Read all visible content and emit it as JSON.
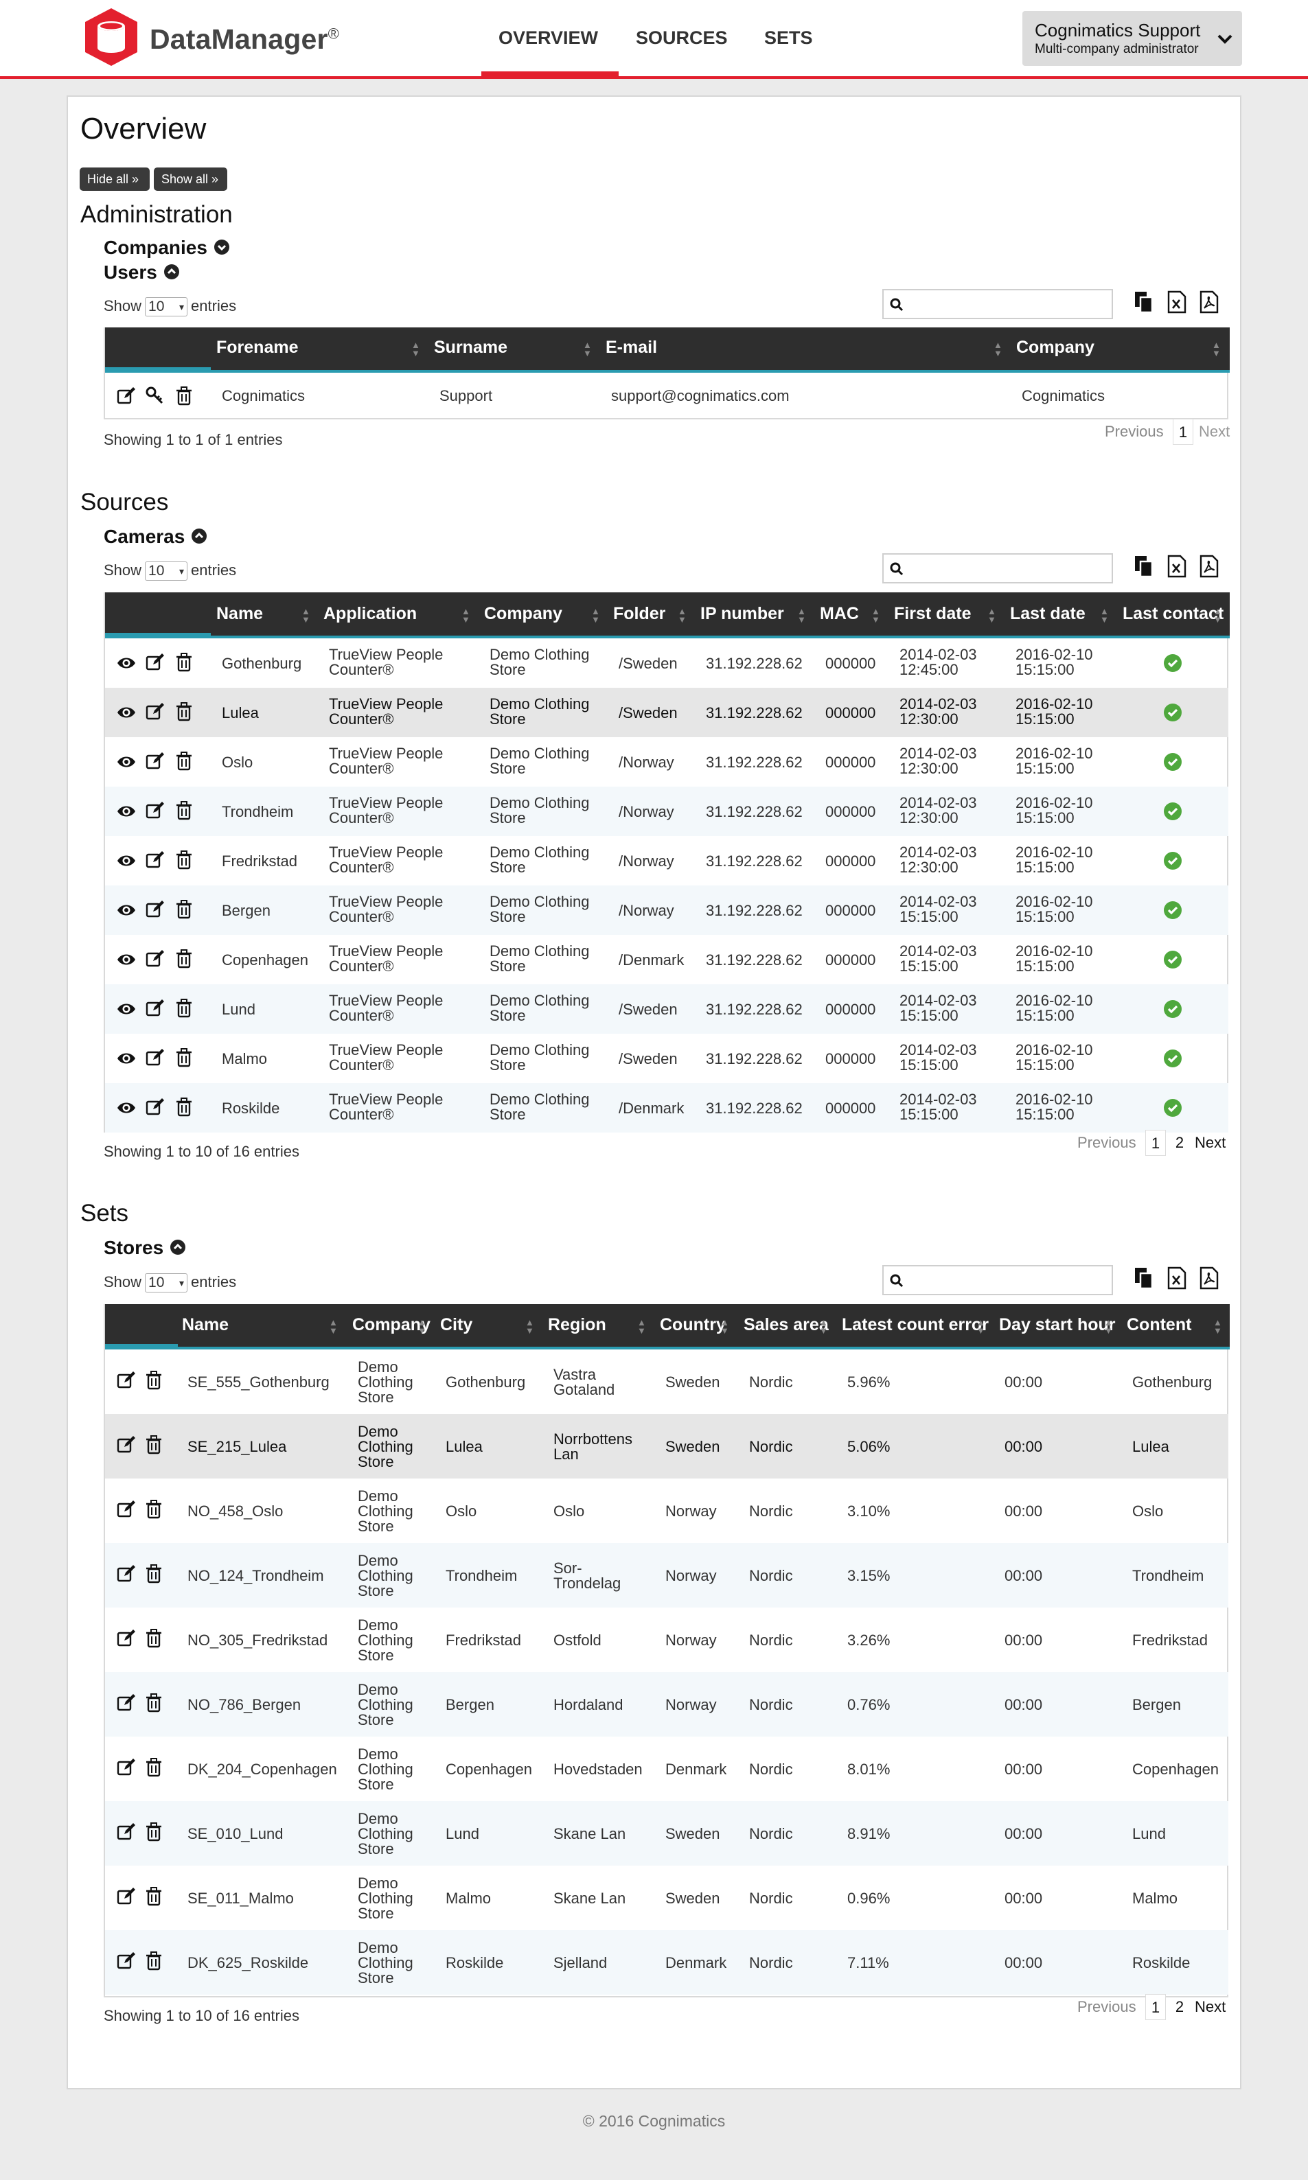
{
  "header": {
    "brand": "DataManager",
    "brand_mark": "®",
    "nav": [
      "OVERVIEW",
      "SOURCES",
      "SETS"
    ],
    "user_name": "Cognimatics Support",
    "user_role": "Multi-company administrator"
  },
  "page": {
    "title": "Overview",
    "hide_all": "Hide all »",
    "show_all": "Show all »"
  },
  "administration": {
    "title": "Administration",
    "companies": "Companies",
    "users": "Users",
    "show_label": "Show",
    "entries_label": "entries",
    "page_size": "10",
    "columns": [
      "Forename",
      "Surname",
      "E-mail",
      "Company"
    ],
    "rows": [
      {
        "forename": "Cognimatics",
        "surname": "Support",
        "email": "support@cognimatics.com",
        "company": "Cognimatics"
      }
    ],
    "info": "Showing 1 to 1 of 1 entries",
    "prev": "Previous",
    "pages": [
      "1"
    ],
    "next": "Next"
  },
  "sources": {
    "title": "Sources",
    "cameras": "Cameras",
    "show_label": "Show",
    "entries_label": "entries",
    "page_size": "10",
    "columns": [
      "Name",
      "Application",
      "Company",
      "Folder",
      "IP number",
      "MAC",
      "First date",
      "Last date",
      "Last contact"
    ],
    "rows": [
      {
        "name": "Gothenburg",
        "app1": "TrueView People",
        "app2": "Counter®",
        "co1": "Demo Clothing",
        "co2": "Store",
        "folder": "/Sweden",
        "ip": "31.192.228.62",
        "mac": "000000",
        "fd1": "2014-02-03",
        "fd2": "12:45:00",
        "ld1": "2016-02-10",
        "ld2": "15:15:00"
      },
      {
        "name": "Lulea",
        "app1": "TrueView People",
        "app2": "Counter®",
        "co1": "Demo Clothing",
        "co2": "Store",
        "folder": "/Sweden",
        "ip": "31.192.228.62",
        "mac": "000000",
        "fd1": "2014-02-03",
        "fd2": "12:30:00",
        "ld1": "2016-02-10",
        "ld2": "15:15:00"
      },
      {
        "name": "Oslo",
        "app1": "TrueView People",
        "app2": "Counter®",
        "co1": "Demo Clothing",
        "co2": "Store",
        "folder": "/Norway",
        "ip": "31.192.228.62",
        "mac": "000000",
        "fd1": "2014-02-03",
        "fd2": "12:30:00",
        "ld1": "2016-02-10",
        "ld2": "15:15:00"
      },
      {
        "name": "Trondheim",
        "app1": "TrueView People",
        "app2": "Counter®",
        "co1": "Demo Clothing",
        "co2": "Store",
        "folder": "/Norway",
        "ip": "31.192.228.62",
        "mac": "000000",
        "fd1": "2014-02-03",
        "fd2": "12:30:00",
        "ld1": "2016-02-10",
        "ld2": "15:15:00"
      },
      {
        "name": "Fredrikstad",
        "app1": "TrueView People",
        "app2": "Counter®",
        "co1": "Demo Clothing",
        "co2": "Store",
        "folder": "/Norway",
        "ip": "31.192.228.62",
        "mac": "000000",
        "fd1": "2014-02-03",
        "fd2": "12:30:00",
        "ld1": "2016-02-10",
        "ld2": "15:15:00"
      },
      {
        "name": "Bergen",
        "app1": "TrueView People",
        "app2": "Counter®",
        "co1": "Demo Clothing",
        "co2": "Store",
        "folder": "/Norway",
        "ip": "31.192.228.62",
        "mac": "000000",
        "fd1": "2014-02-03",
        "fd2": "15:15:00",
        "ld1": "2016-02-10",
        "ld2": "15:15:00"
      },
      {
        "name": "Copenhagen",
        "app1": "TrueView People",
        "app2": "Counter®",
        "co1": "Demo Clothing",
        "co2": "Store",
        "folder": "/Denmark",
        "ip": "31.192.228.62",
        "mac": "000000",
        "fd1": "2014-02-03",
        "fd2": "15:15:00",
        "ld1": "2016-02-10",
        "ld2": "15:15:00"
      },
      {
        "name": "Lund",
        "app1": "TrueView People",
        "app2": "Counter®",
        "co1": "Demo Clothing",
        "co2": "Store",
        "folder": "/Sweden",
        "ip": "31.192.228.62",
        "mac": "000000",
        "fd1": "2014-02-03",
        "fd2": "15:15:00",
        "ld1": "2016-02-10",
        "ld2": "15:15:00"
      },
      {
        "name": "Malmo",
        "app1": "TrueView People",
        "app2": "Counter®",
        "co1": "Demo Clothing",
        "co2": "Store",
        "folder": "/Sweden",
        "ip": "31.192.228.62",
        "mac": "000000",
        "fd1": "2014-02-03",
        "fd2": "15:15:00",
        "ld1": "2016-02-10",
        "ld2": "15:15:00"
      },
      {
        "name": "Roskilde",
        "app1": "TrueView People",
        "app2": "Counter®",
        "co1": "Demo Clothing",
        "co2": "Store",
        "folder": "/Denmark",
        "ip": "31.192.228.62",
        "mac": "000000",
        "fd1": "2014-02-03",
        "fd2": "15:15:00",
        "ld1": "2016-02-10",
        "ld2": "15:15:00"
      }
    ],
    "info": "Showing 1 to 10 of 16 entries",
    "prev": "Previous",
    "pages": [
      "1",
      "2"
    ],
    "next": "Next"
  },
  "sets": {
    "title": "Sets",
    "stores": "Stores",
    "show_label": "Show",
    "entries_label": "entries",
    "page_size": "10",
    "columns": [
      "Name",
      "Company",
      "City",
      "Region",
      "Country",
      "Sales area",
      "Latest count error",
      "Day start hour",
      "Content"
    ],
    "rows": [
      {
        "name": "SE_555_Gothenburg",
        "city": "Gothenburg",
        "r1": "Vastra",
        "r2": "Gotaland",
        "country": "Sweden",
        "area": "Nordic",
        "err": "5.96%",
        "hour": "00:00",
        "content": "Gothenburg"
      },
      {
        "name": "SE_215_Lulea",
        "city": "Lulea",
        "r1": "Norrbottens",
        "r2": "Lan",
        "country": "Sweden",
        "area": "Nordic",
        "err": "5.06%",
        "hour": "00:00",
        "content": "Lulea"
      },
      {
        "name": "NO_458_Oslo",
        "city": "Oslo",
        "r1": "Oslo",
        "r2": "",
        "country": "Norway",
        "area": "Nordic",
        "err": "3.10%",
        "hour": "00:00",
        "content": "Oslo"
      },
      {
        "name": "NO_124_Trondheim",
        "city": "Trondheim",
        "r1": "Sor-",
        "r2": "Trondelag",
        "country": "Norway",
        "area": "Nordic",
        "err": "3.15%",
        "hour": "00:00",
        "content": "Trondheim"
      },
      {
        "name": "NO_305_Fredrikstad",
        "city": "Fredrikstad",
        "r1": "Ostfold",
        "r2": "",
        "country": "Norway",
        "area": "Nordic",
        "err": "3.26%",
        "hour": "00:00",
        "content": "Fredrikstad"
      },
      {
        "name": "NO_786_Bergen",
        "city": "Bergen",
        "r1": "Hordaland",
        "r2": "",
        "country": "Norway",
        "area": "Nordic",
        "err": "0.76%",
        "hour": "00:00",
        "content": "Bergen"
      },
      {
        "name": "DK_204_Copenhagen",
        "city": "Copenhagen",
        "r1": "Hovedstaden",
        "r2": "",
        "country": "Denmark",
        "area": "Nordic",
        "err": "8.01%",
        "hour": "00:00",
        "content": "Copenhagen"
      },
      {
        "name": "SE_010_Lund",
        "city": "Lund",
        "r1": "Skane Lan",
        "r2": "",
        "country": "Sweden",
        "area": "Nordic",
        "err": "8.91%",
        "hour": "00:00",
        "content": "Lund"
      },
      {
        "name": "SE_011_Malmo",
        "city": "Malmo",
        "r1": "Skane Lan",
        "r2": "",
        "country": "Sweden",
        "area": "Nordic",
        "err": "0.96%",
        "hour": "00:00",
        "content": "Malmo"
      },
      {
        "name": "DK_625_Roskilde",
        "city": "Roskilde",
        "r1": "Sjelland",
        "r2": "",
        "country": "Denmark",
        "area": "Nordic",
        "err": "7.11%",
        "hour": "00:00",
        "content": "Roskilde"
      }
    ],
    "company_lines": [
      "Demo",
      "Clothing",
      "Store"
    ],
    "info": "Showing 1 to 10 of 16 entries",
    "prev": "Previous",
    "pages": [
      "1",
      "2"
    ],
    "next": "Next"
  },
  "footer": {
    "copyright": "© 2016 Cognimatics"
  },
  "colors": {
    "accent_red": "#e3202e",
    "header_dark": "#2e2e2e",
    "teal": "#2a9bb0",
    "ok_green": "#4fa83d"
  }
}
